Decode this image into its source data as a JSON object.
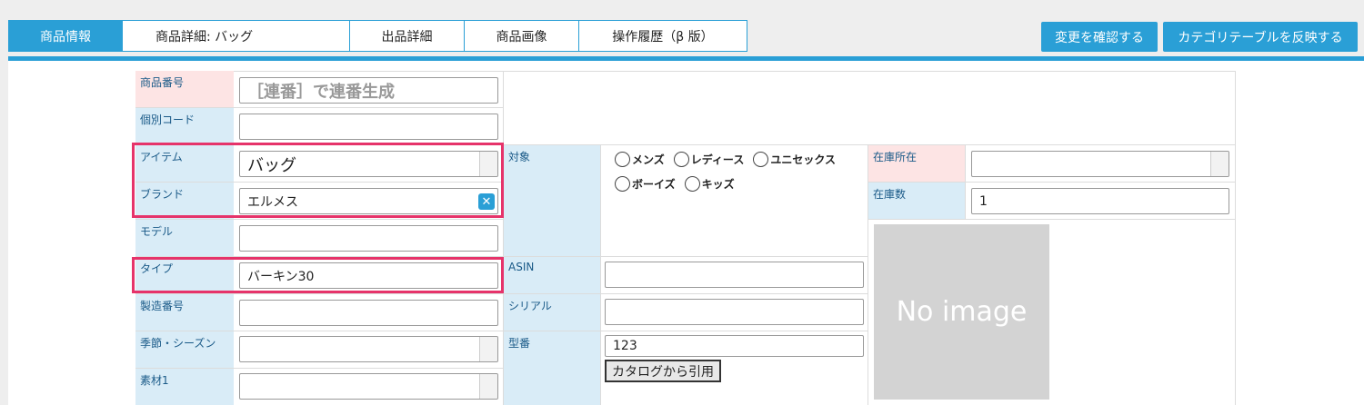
{
  "tabs": [
    {
      "label": "商品情報"
    },
    {
      "label": "商品詳細: バッグ"
    },
    {
      "label": "出品詳細"
    },
    {
      "label": "商品画像"
    },
    {
      "label": "操作履歴（β 版）"
    }
  ],
  "actions": {
    "confirm_label": "変更を確認する",
    "reflect_label": "カテゴリテーブルを反映する"
  },
  "form": {
    "product_number": {
      "label": "商品番号",
      "placeholder": "［連番］で連番生成"
    },
    "individual_code": {
      "label": "個別コード",
      "value": ""
    },
    "item": {
      "label": "アイテム",
      "value": "バッグ"
    },
    "brand": {
      "label": "ブランド",
      "value": "エルメス",
      "clear_icon": "close-icon"
    },
    "model": {
      "label": "モデル",
      "value": ""
    },
    "type": {
      "label": "タイプ",
      "value": "バーキン30"
    },
    "serial_no": {
      "label": "製造番号",
      "value": ""
    },
    "season": {
      "label": "季節・シーズン",
      "value": ""
    },
    "material": {
      "label": "素材1",
      "value": ""
    },
    "target": {
      "label": "対象",
      "options": [
        "メンズ",
        "レディース",
        "ユニセックス",
        "ボーイズ",
        "キッズ"
      ]
    },
    "asin": {
      "label": "ASIN",
      "value": ""
    },
    "serial": {
      "label": "シリアル",
      "value": ""
    },
    "model_number": {
      "label": "型番",
      "value": "123",
      "catalog_button": "カタログから引用"
    },
    "stock_location": {
      "label": "在庫所在",
      "value": ""
    },
    "stock_count": {
      "label": "在庫数",
      "value": "1"
    },
    "image": {
      "placeholder_text": "No image"
    }
  },
  "colors": {
    "accent": "#2a9fd6",
    "highlight": "#e6336a"
  }
}
